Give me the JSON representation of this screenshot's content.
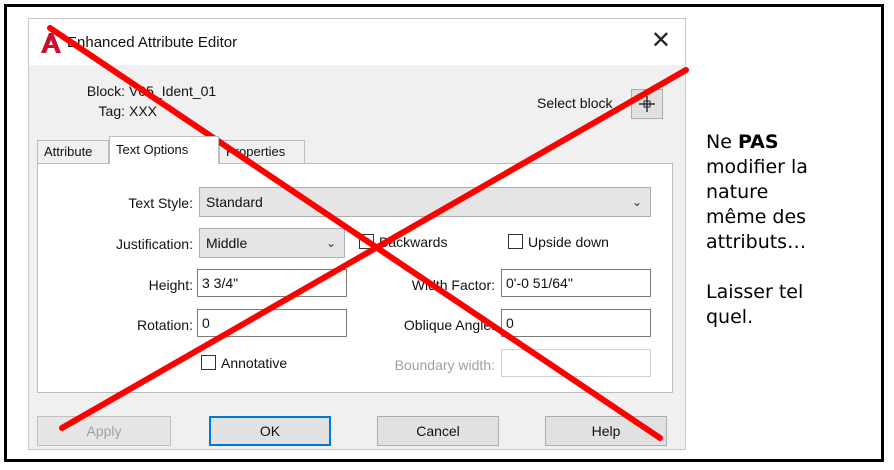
{
  "dialog": {
    "title": "Enhanced Attribute Editor",
    "close_glyph": "✕",
    "block_label": "Block:",
    "block_value": "V05_Ident_01",
    "tag_label": "Tag:",
    "tag_value": "XXX",
    "select_block_label": "Select block",
    "tabs": [
      {
        "label": "Attribute",
        "active": false
      },
      {
        "label": "Text Options",
        "active": true
      },
      {
        "label": "Properties",
        "active": false
      }
    ],
    "text_style": {
      "label": "Text Style:",
      "value": "Standard"
    },
    "justification": {
      "label": "Justification:",
      "value": "Middle"
    },
    "backwards": {
      "label": "Backwards",
      "checked": false
    },
    "upside_down": {
      "label": "Upside down",
      "checked": false
    },
    "height": {
      "label": "Height:",
      "value": "3 3/4\""
    },
    "width_factor": {
      "label": "Width Factor:",
      "value": "0'-0 51/64\""
    },
    "rotation": {
      "label": "Rotation:",
      "value": "0"
    },
    "oblique_angle": {
      "label": "Oblique Angle:",
      "value": "0"
    },
    "annotative": {
      "label": "Annotative",
      "checked": false
    },
    "boundary_width": {
      "label": "Boundary width:",
      "value": "",
      "enabled": false
    },
    "buttons": {
      "apply": "Apply",
      "ok": "OK",
      "cancel": "Cancel",
      "help": "Help"
    }
  },
  "note": {
    "line1_prefix": "Ne ",
    "line1_bold": "PAS",
    "line2": "modifier la",
    "line3": "nature",
    "line4": "même des",
    "line5": "attributs…",
    "line6": "Laisser tel",
    "line7": "quel."
  },
  "colors": {
    "cross": "#ff0000",
    "accent": "#0078d7",
    "app_icon": "#c8102e"
  },
  "icons": {
    "app": "autocad-a-icon",
    "pick": "pick-crosshair-icon",
    "dropdown": "chevron-down-icon"
  }
}
